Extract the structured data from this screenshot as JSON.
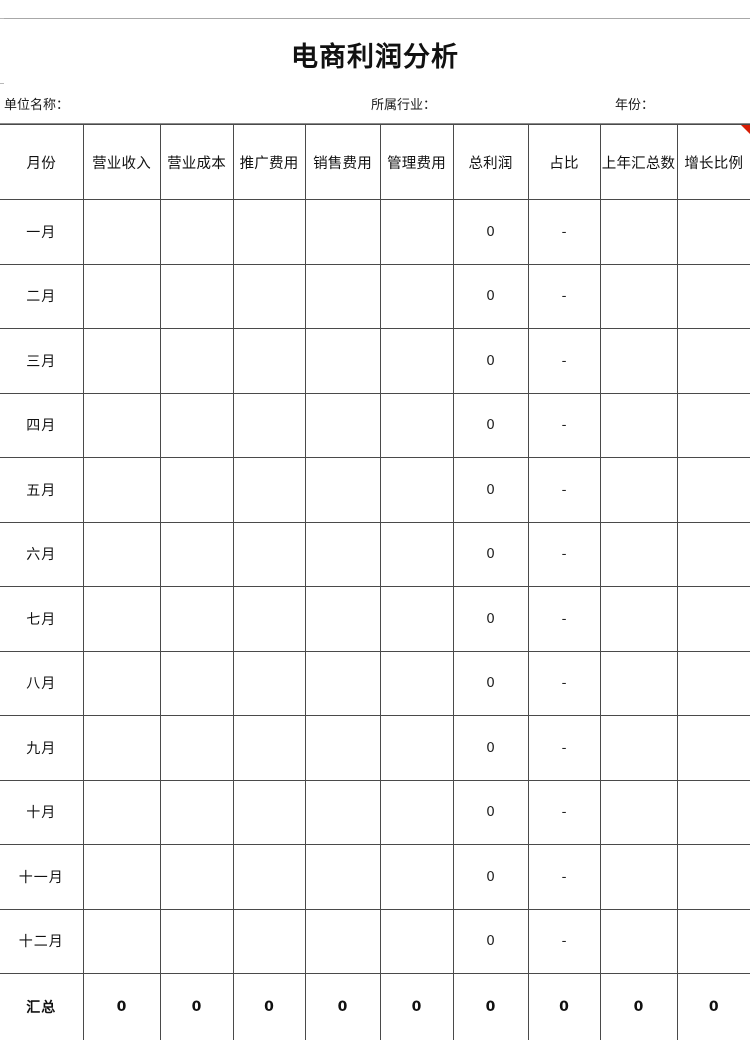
{
  "document": {
    "title": "电商利润分析"
  },
  "meta": {
    "unit_label": "单位名称：",
    "industry_label": "所属行业：",
    "year_label": "年份："
  },
  "table": {
    "columns": [
      "月份",
      "营业收入",
      "营业成本",
      "推广费用",
      "销售费用",
      "管理费用",
      "总利润",
      "占比",
      "上年汇总数",
      "增长比例"
    ],
    "rows": [
      {
        "month": "一月",
        "revenue": "",
        "cost": "",
        "promo": "",
        "sales": "",
        "admin": "",
        "profit": "0",
        "share": "-",
        "last_year": "",
        "growth": ""
      },
      {
        "month": "二月",
        "revenue": "",
        "cost": "",
        "promo": "",
        "sales": "",
        "admin": "",
        "profit": "0",
        "share": "-",
        "last_year": "",
        "growth": ""
      },
      {
        "month": "三月",
        "revenue": "",
        "cost": "",
        "promo": "",
        "sales": "",
        "admin": "",
        "profit": "0",
        "share": "-",
        "last_year": "",
        "growth": ""
      },
      {
        "month": "四月",
        "revenue": "",
        "cost": "",
        "promo": "",
        "sales": "",
        "admin": "",
        "profit": "0",
        "share": "-",
        "last_year": "",
        "growth": ""
      },
      {
        "month": "五月",
        "revenue": "",
        "cost": "",
        "promo": "",
        "sales": "",
        "admin": "",
        "profit": "0",
        "share": "-",
        "last_year": "",
        "growth": ""
      },
      {
        "month": "六月",
        "revenue": "",
        "cost": "",
        "promo": "",
        "sales": "",
        "admin": "",
        "profit": "0",
        "share": "-",
        "last_year": "",
        "growth": ""
      },
      {
        "month": "七月",
        "revenue": "",
        "cost": "",
        "promo": "",
        "sales": "",
        "admin": "",
        "profit": "0",
        "share": "-",
        "last_year": "",
        "growth": ""
      },
      {
        "month": "八月",
        "revenue": "",
        "cost": "",
        "promo": "",
        "sales": "",
        "admin": "",
        "profit": "0",
        "share": "-",
        "last_year": "",
        "growth": ""
      },
      {
        "month": "九月",
        "revenue": "",
        "cost": "",
        "promo": "",
        "sales": "",
        "admin": "",
        "profit": "0",
        "share": "-",
        "last_year": "",
        "growth": ""
      },
      {
        "month": "十月",
        "revenue": "",
        "cost": "",
        "promo": "",
        "sales": "",
        "admin": "",
        "profit": "0",
        "share": "-",
        "last_year": "",
        "growth": ""
      },
      {
        "month": "十一月",
        "revenue": "",
        "cost": "",
        "promo": "",
        "sales": "",
        "admin": "",
        "profit": "0",
        "share": "-",
        "last_year": "",
        "growth": ""
      },
      {
        "month": "十二月",
        "revenue": "",
        "cost": "",
        "promo": "",
        "sales": "",
        "admin": "",
        "profit": "0",
        "share": "-",
        "last_year": "",
        "growth": ""
      }
    ],
    "total_row": {
      "month": "汇总",
      "revenue": "0",
      "cost": "0",
      "promo": "0",
      "sales": "0",
      "admin": "0",
      "profit": "0",
      "share": "0",
      "last_year": "0",
      "growth": "0"
    }
  },
  "annotations": {
    "comment_marker_column": "增长比例"
  },
  "colors": {
    "grid_line": "#4a4a4a",
    "rule_line": "#8a8a8a",
    "text": "#111111",
    "comment_marker": "#d81e06",
    "background": "#ffffff"
  }
}
